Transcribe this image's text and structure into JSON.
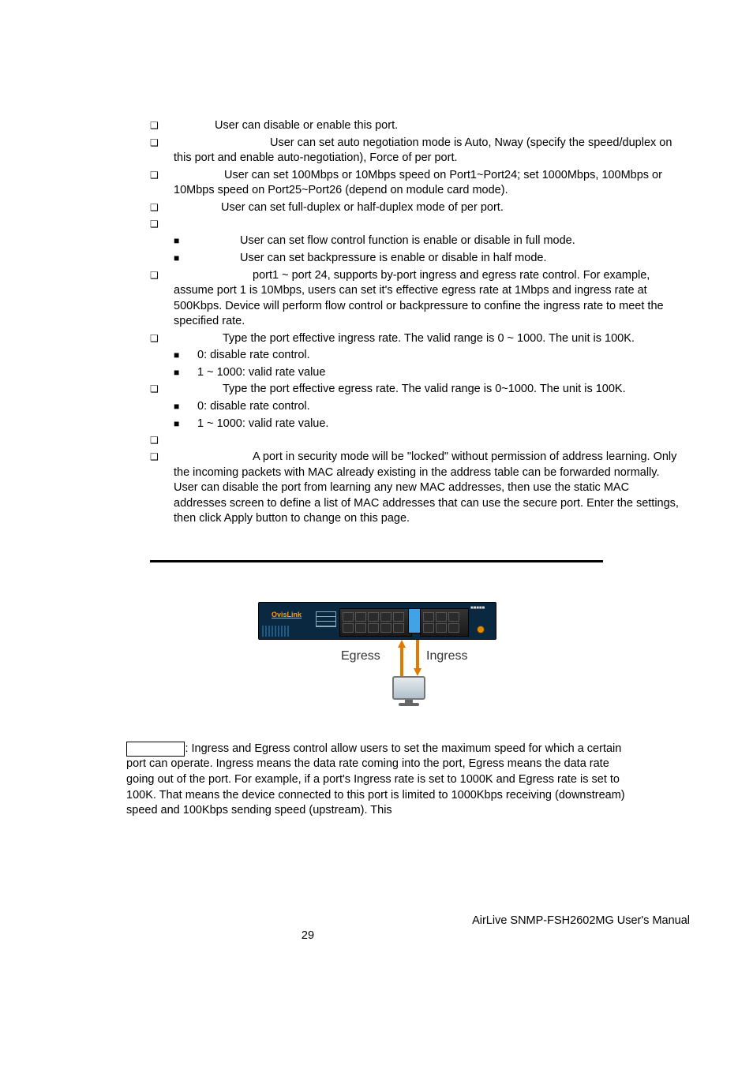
{
  "list": {
    "i0": {
      "text": "User can disable or enable this port.",
      "lead": 52
    },
    "i1": {
      "text": "User can set auto negotiation mode is Auto, Nway (specify the speed/duplex on this port and enable auto-negotiation), Force of per port.",
      "lead": 122
    },
    "i2": {
      "text": "User can set 100Mbps or 10Mbps speed on Port1~Port24; set 1000Mbps, 100Mbps or 10Mbps speed on Port25~Port26 (depend on module card mode).",
      "lead": 64
    },
    "i3": {
      "text": "User can set full-duplex or half-duplex mode of per port.",
      "lead": 60
    },
    "i4": {
      "text": "",
      "lead": 0
    },
    "i4a": {
      "text": "User can set flow control function is enable or disable in full mode.",
      "lead": 54
    },
    "i4b": {
      "text": "User can set backpressure is enable or disable in half mode.",
      "lead": 54
    },
    "i5": {
      "text": "port1 ~ port 24, supports by-port ingress and egress rate control. For example, assume port 1 is 10Mbps, users can set it's effective egress rate at 1Mbps and ingress rate at 500Kbps. Device will perform flow control or backpressure to confine the ingress rate to meet the specified rate.",
      "lead": 100
    },
    "i6": {
      "text": "Type the port effective ingress rate. The valid range is 0 ~ 1000. The unit is 100K.",
      "lead": 62
    },
    "i6a": {
      "text": "0: disable rate control."
    },
    "i6b": {
      "text": "1 ~ 1000: valid rate value"
    },
    "i7": {
      "text": "Type the port effective egress rate. The valid range is 0~1000. The unit is 100K.",
      "lead": 62
    },
    "i7a": {
      "text": "0: disable rate control."
    },
    "i7b": {
      "text": "1 ~ 1000: valid rate value."
    },
    "i8": {
      "text": "",
      "lead": 0
    },
    "i9": {
      "text": "A port in security mode will be \"locked\" without permission of address learning. Only the incoming packets with MAC already existing in the address table can be forwarded normally. User can disable the port from learning any new MAC addresses, then use the static MAC addresses screen to define a list of MAC addresses that can use the secure port. Enter the settings, then click Apply button to change on this page.",
      "lead": 100
    }
  },
  "figure": {
    "brand": "OvisLink",
    "egress_label": "Egress",
    "ingress_label": "Ingress"
  },
  "note": {
    "text": ": Ingress and Egress control allow users to set the maximum speed for which a certain port can operate.  Ingress means the data rate coming into the port, Egress means the data rate going out of the port.  For example, if a port's Ingress rate is set to 1000K and Egress rate is set to 100K.  That means the device connected to this port is limited to 1000Kbps receiving (downstream) speed and 100Kbps sending speed (upstream).  This"
  },
  "footer": {
    "right": "AirLive SNMP-FSH2602MG User's Manual",
    "page": "29"
  }
}
